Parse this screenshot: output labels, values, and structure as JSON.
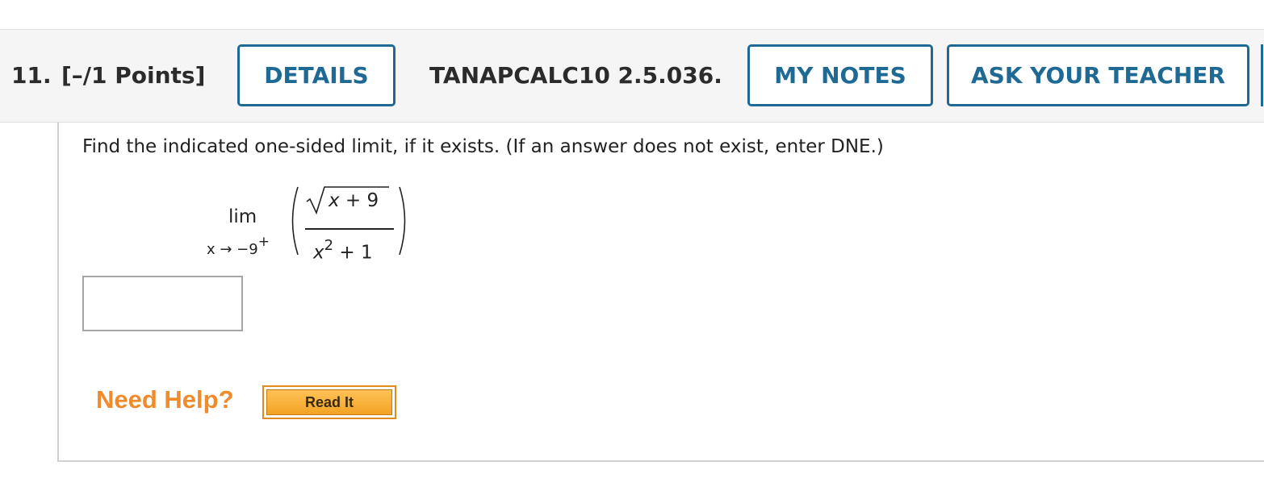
{
  "header": {
    "question_number": "11.",
    "points": "[–/1 Points]",
    "details_label": "DETAILS",
    "problem_id": "TANAPCALC10 2.5.036.",
    "my_notes_label": "MY NOTES",
    "ask_teacher_label": "ASK YOUR TEACHER"
  },
  "question": {
    "instruction": "Find the indicated one-sided limit, if it exists. (If an answer does not exist, enter DNE.)",
    "lim_word": "lim",
    "lim_sub": "x → −9",
    "lim_sub_sup": "+",
    "numerator_var": "x",
    "numerator_rest": " + 9",
    "denominator_var": "x",
    "denominator_exp": "2",
    "denominator_rest": " + 1",
    "answer_value": ""
  },
  "help": {
    "need_help_label": "Need Help?",
    "read_it_label": "Read It"
  },
  "colors": {
    "accent": "#1f6a95",
    "help_orange": "#f08a2b",
    "read_it_fill": "#f2a325"
  }
}
